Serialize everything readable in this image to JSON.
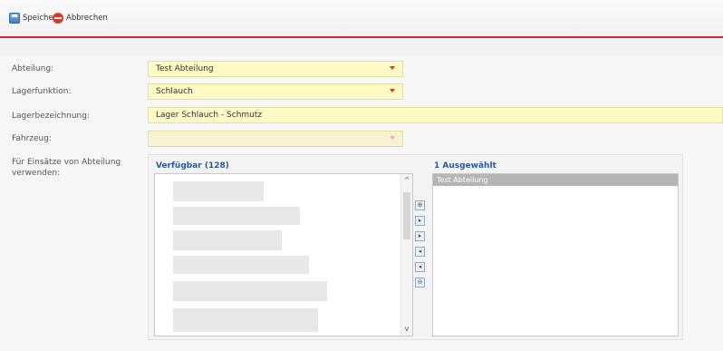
{
  "toolbar": {
    "save_label": "Speichern",
    "cancel_label": "Abbrechen"
  },
  "form": {
    "abteilung": {
      "label": "Abteilung:",
      "value": "Test Abteilung"
    },
    "lagerfunktion": {
      "label": "Lagerfunktion:",
      "value": "Schlauch"
    },
    "lagerbezeichnung": {
      "label": "Lagerbezeichnung:",
      "value": "Lager Schlauch - Schmutz"
    },
    "fahrzeug": {
      "label": "Fahrzeug:",
      "value": ""
    },
    "einsaetze": {
      "label_line1": "Für Einsätze von Abteilung",
      "label_line2": "verwenden:"
    }
  },
  "picker": {
    "available_title": "Verfügbar (128)",
    "selected_title": "1 Ausgewählt",
    "selected_items": [
      "Test Abteilung"
    ],
    "move_buttons": [
      "move-all-right",
      "move-right",
      "move-right",
      "move-left",
      "move-left",
      "move-all-left"
    ]
  },
  "icons": {
    "save": "save-icon",
    "cancel": "cancel-icon",
    "dropdown": "dropdown-arrow-icon",
    "move_buttons": [
      "⊕",
      "▸",
      "▸",
      "◂",
      "◂",
      "⊖"
    ]
  },
  "colors": {
    "toolbar_rule": "#cc2a2a",
    "field_bg": "#fdfac6",
    "title_blue": "#2b5a9c",
    "selected_row": "#b5b5b5"
  }
}
